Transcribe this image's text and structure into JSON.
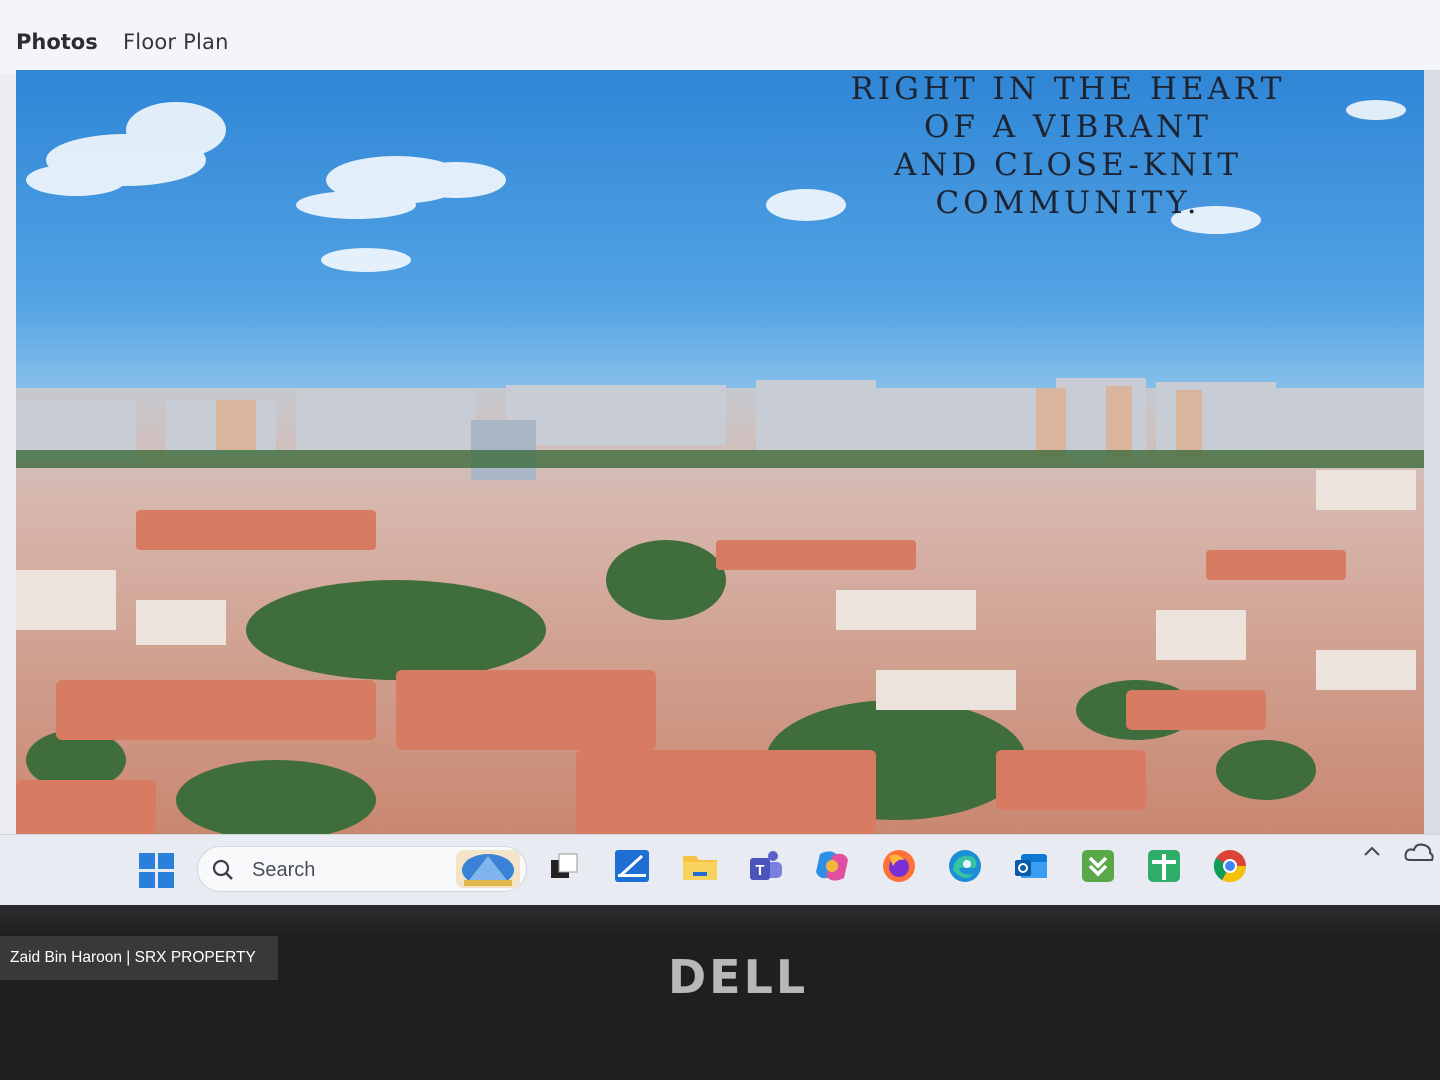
{
  "tabs": [
    {
      "label": "Photos",
      "active": true
    },
    {
      "label": "Floor Plan",
      "active": false
    }
  ],
  "photo": {
    "headline": "RIGHT IN THE HEART\nOF A VIBRANT\nAND CLOSE-KNIT\nCOMMUNITY."
  },
  "taskbar": {
    "search_label": "Search",
    "apps": [
      "windows-start-icon",
      "task-view-icon",
      "snipping-tool-icon",
      "file-explorer-icon",
      "teams-icon",
      "copilot-icon",
      "firefox-icon",
      "edge-icon",
      "outlook-icon",
      "green-download-app-icon",
      "green-plus-app-icon",
      "chrome-icon"
    ]
  },
  "bezel": {
    "brand": "DELL"
  },
  "watermark": "Zaid Bin Haroon | SRX PROPERTY",
  "colors": {
    "tab_underline": "#8b1d22",
    "sky": "#3d8ed9",
    "taskbar": "#e8ebf1",
    "bezel": "#1f1e20"
  }
}
